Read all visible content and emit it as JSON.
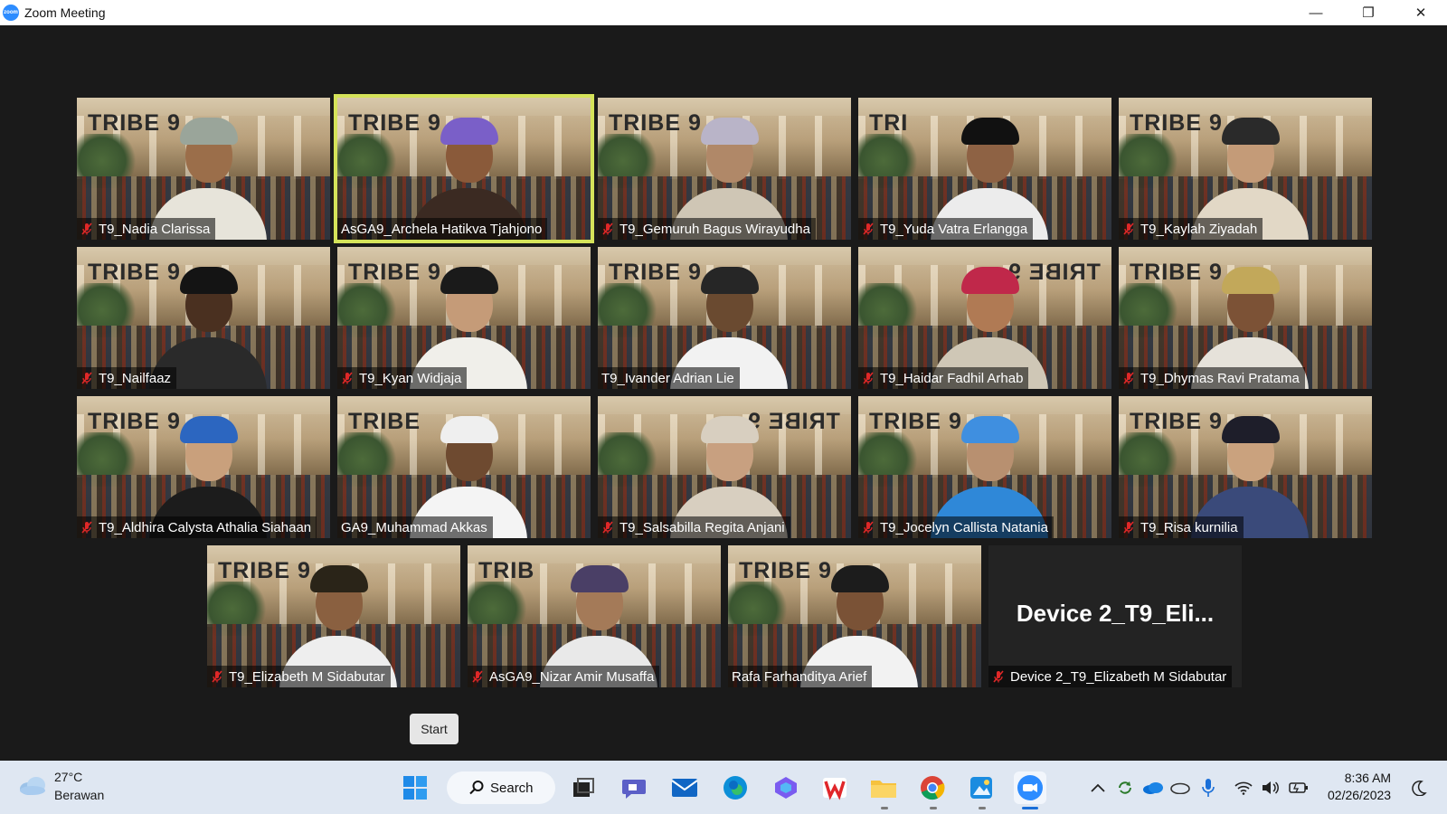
{
  "window": {
    "title": "Zoom Meeting",
    "app_icon_label": "zoom"
  },
  "window_controls": {
    "minimize": "—",
    "restore": "❐",
    "close": "✕"
  },
  "tiles": [
    {
      "name": "T9_Nadia Clarissa",
      "muted": true,
      "brand": "TRIBE 9",
      "hat": "#9aa59a",
      "skin": "#9b6e4a",
      "shirt": "#e7e4da"
    },
    {
      "name": "AsGA9_Archela Hatikva Tjahjono",
      "muted": false,
      "brand": "TRIBE 9",
      "hat": "#7a5fc8",
      "skin": "#8a5a3a",
      "shirt": "#3b2a22",
      "active": true
    },
    {
      "name": "T9_Gemuruh Bagus Wirayudha",
      "muted": true,
      "brand": "TRIBE 9",
      "hat": "#b9b4c8",
      "skin": "#b08868",
      "shirt": "#cfc6b5"
    },
    {
      "name": "T9_Yuda Vatra Erlangga",
      "muted": true,
      "brand": "TRI",
      "hat": "#111111",
      "skin": "#8e6244",
      "shirt": "#ececec"
    },
    {
      "name": "T9_Kaylah Ziyadah",
      "muted": true,
      "brand": "TRIBE 9",
      "hat": "#2a2a2a",
      "skin": "#c49b78",
      "shirt": "#e2d8c6"
    },
    {
      "name": "T9_Nailfaaz",
      "muted": true,
      "brand": "TRIBE 9",
      "hat": "#141414",
      "skin": "#4a3020",
      "shirt": "#2a2a2a"
    },
    {
      "name": "T9_Kyan Widjaja",
      "muted": true,
      "brand": "TRIBE 9",
      "hat": "#1a1a1a",
      "skin": "#c59b78",
      "shirt": "#f0efea"
    },
    {
      "name": "T9_Ivander Adrian Lie",
      "muted": false,
      "brand": "TRIBE 9",
      "hat": "#262626",
      "skin": "#6a4a30",
      "shirt": "#f2f2f2"
    },
    {
      "name": "T9_Haidar Fadhil Arhab",
      "muted": true,
      "brand": "TRIBE 9",
      "brand_mirror": true,
      "hat": "#c0284a",
      "skin": "#b07a54",
      "shirt": "#cfc7b6"
    },
    {
      "name": "T9_Dhymas Ravi Pratama",
      "muted": true,
      "brand": "TRIBE 9",
      "hat": "#c2a85a",
      "skin": "#7c5236",
      "shirt": "#e6e2da"
    },
    {
      "name": "T9_Aldhira Calysta Athalia Siahaan",
      "muted": true,
      "brand": "TRIBE 9",
      "hat": "#2c66c0",
      "skin": "#c9a07c",
      "shirt": "#1c1c1c"
    },
    {
      "name": "GA9_Muhammad Akkas",
      "muted": false,
      "brand": "TRIBE",
      "hat": "#efefef",
      "skin": "#6e4a30",
      "shirt": "#f4f4f4"
    },
    {
      "name": "T9_Salsabilla Regita Anjani",
      "muted": true,
      "brand": "TRIBE 9",
      "brand_mirror": true,
      "hat": "#d8cfc0",
      "skin": "#c8a080",
      "shirt": "#d8cfc0"
    },
    {
      "name": "T9_Jocelyn Callista Natania",
      "muted": true,
      "brand": "TRIBE 9",
      "hat": "#3f8fe0",
      "skin": "#b89070",
      "shirt": "#2f88d8"
    },
    {
      "name": "T9_Risa kurnilia",
      "muted": true,
      "brand": "TRIBE 9",
      "hat": "#1e1e2a",
      "skin": "#caa27e",
      "shirt": "#3a4a7a"
    },
    {
      "name": "T9_Elizabeth M Sidabutar",
      "muted": true,
      "brand": "TRIBE 9",
      "hat": "#2a2418",
      "skin": "#8a6040",
      "shirt": "#eeeeee"
    },
    {
      "name": "AsGA9_Nizar Amir Musaffa",
      "muted": true,
      "brand": "TRIB",
      "hat": "#4a3f66",
      "skin": "#a47a58",
      "shirt": "#e9e9e9"
    },
    {
      "name": "Rafa Farhanditya Arief",
      "muted": false,
      "brand": "TRIBE 9",
      "hat": "#1c1c1c",
      "skin": "#7a5236",
      "shirt": "#f2f2f2"
    },
    {
      "name": "Device 2_T9_Elizabeth M Sidabutar",
      "muted": true,
      "device": true,
      "big_label": "Device  2_T9_Eli..."
    }
  ],
  "start_button": {
    "label": "Start"
  },
  "taskbar": {
    "weather": {
      "temp": "27°C",
      "desc": "Berawan"
    },
    "search": {
      "label": "Search"
    },
    "apps": [
      "windows-start",
      "search",
      "task-view",
      "chat",
      "mail",
      "edge",
      "copilot",
      "wps-office",
      "file-explorer",
      "chrome",
      "photos",
      "zoom"
    ],
    "clock": {
      "time": "8:36 AM",
      "date": "02/26/2023"
    }
  },
  "colors": {
    "active_speaker": "#d5e35a",
    "mute_red": "#e02828",
    "zoom_blue": "#2d8cff",
    "taskbar": "#dfe7f2"
  }
}
